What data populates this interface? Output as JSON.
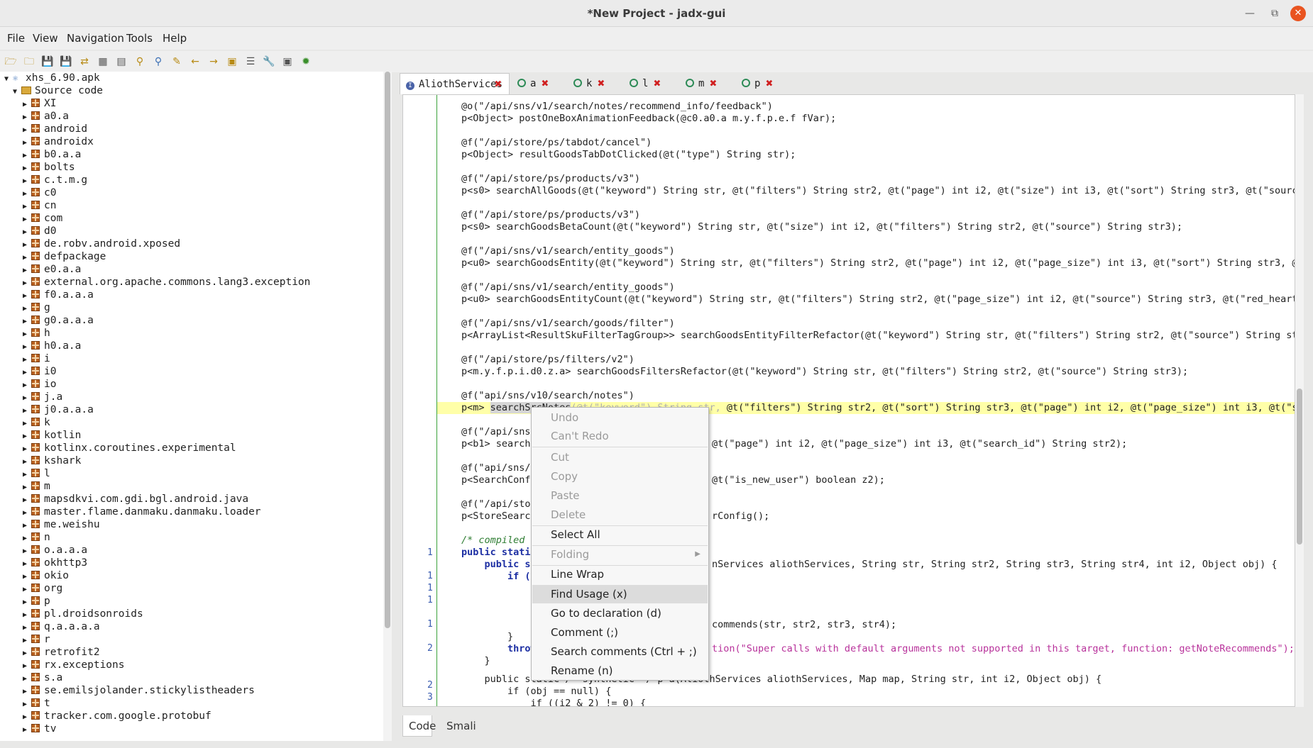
{
  "window": {
    "title": "*New Project - jadx-gui",
    "min_icon": "minimize-icon",
    "max_icon": "maximize-icon",
    "close_icon": "close-icon"
  },
  "menubar": [
    "File",
    "View",
    "Navigation",
    "Tools",
    "Help"
  ],
  "toolbar_icons": [
    "open-folder-icon",
    "add-files-icon",
    "save-icon",
    "save-all-icon",
    "export-icon",
    "sync-icon",
    "flatten-icon",
    "key-icon",
    "search-icon",
    "find-text-icon",
    "back-icon",
    "forward-icon",
    "quark-icon",
    "log-icon",
    "preferences-icon",
    "deobfuscation-icon",
    "debug-icon"
  ],
  "tree": {
    "root": "xhs_6.90.apk",
    "source": "Source code",
    "packages": [
      "XI",
      "a0.a",
      "android",
      "androidx",
      "b0.a.a",
      "bolts",
      "c.t.m.g",
      "c0",
      "cn",
      "com",
      "d0",
      "de.robv.android.xposed",
      "defpackage",
      "e0.a.a",
      "external.org.apache.commons.lang3.exception",
      "f0.a.a.a",
      "g",
      "g0.a.a.a",
      "h",
      "h0.a.a",
      "i",
      "i0",
      "io",
      "j.a",
      "j0.a.a.a",
      "k",
      "kotlin",
      "kotlinx.coroutines.experimental",
      "kshark",
      "l",
      "m",
      "mapsdkvi.com.gdi.bgl.android.java",
      "master.flame.danmaku.danmaku.loader",
      "me.weishu",
      "n",
      "o.a.a.a",
      "okhttp3",
      "okio",
      "org",
      "p",
      "pl.droidsonroids",
      "q.a.a.a.a",
      "r",
      "retrofit2",
      "rx.exceptions",
      "s.a",
      "se.emilsjolander.stickylistheaders",
      "t",
      "tracker.com.google.protobuf",
      "tv"
    ]
  },
  "tabs": [
    {
      "label": "AliothServices",
      "active": true
    },
    {
      "label": "a"
    },
    {
      "label": "k"
    },
    {
      "label": "l"
    },
    {
      "label": "m"
    },
    {
      "label": "p"
    }
  ],
  "gutter": [
    "1",
    "1",
    "1",
    "1",
    "1",
    "2",
    "2",
    "3"
  ],
  "code": {
    "l1a": "@o(\"/api/sns/v1/search/notes/recommend_info/feedback\")",
    "l2a": "p<Object> postOneBoxAnimationFeedback(@c0.a0.a m.y.f.p.e.f fVar);",
    "l3a": "@f(\"/api/store/ps/tabdot/cancel\")",
    "l4a": "p<Object> resultGoodsTabDotClicked(@t(\"type\") String str);",
    "l5a": "@f(\"/api/store/ps/products/v3\")",
    "l6a": "p<s0> searchAllGoods(@t(\"keyword\") String str, @t(\"filters\") String str2, @t(\"page\") int i2, @t(\"size\") int i3, @t(\"sort\") String str3, @t(\"source\"",
    "l7a": "@f(\"/api/store/ps/products/v3\")",
    "l8a": "p<s0> searchGoodsBetaCount(@t(\"keyword\") String str, @t(\"size\") int i2, @t(\"filters\") String str2, @t(\"source\") String str3);",
    "l9a": "@f(\"/api/sns/v1/search/entity_goods\")",
    "l10a": "p<u0> searchGoodsEntity(@t(\"keyword\") String str, @t(\"filters\") String str2, @t(\"page\") int i2, @t(\"page_size\") int i3, @t(\"sort\") String str3, @t(",
    "l11a": "@f(\"/api/sns/v1/search/entity_goods\")",
    "l12a": "p<u0> searchGoodsEntityCount(@t(\"keyword\") String str, @t(\"filters\") String str2, @t(\"page_size\") int i2, @t(\"source\") String str3, @t(\"red_heart\")",
    "l13a": "@f(\"/api/sns/v1/search/goods/filter\")",
    "l14a": "p<ArrayList<ResultSkuFilterTagGroup>> searchGoodsEntityFilterRefactor(@t(\"keyword\") String str, @t(\"filters\") String str2, @t(\"source\") String str3",
    "l15a": "@f(\"/api/store/ps/filters/v2\")",
    "l16a": "p<m.y.f.p.i.d0.z.a> searchGoodsFiltersRefactor(@t(\"keyword\") String str, @t(\"filters\") String str2, @t(\"source\") String str3);",
    "l17a": "@f(\"api/sns/v10/search/notes\")",
    "l18_pre": "p<m> ",
    "l18_sel": "searchSrcNotes",
    "l18_mid": "(@t(\"keyword\") String str,",
    "l18_post": " @t(\"filters\") String str2, @t(\"sort\") String str3, @t(\"page\") int i2, @t(\"page_size\") int i3, @t(\"sou",
    "l19a": "@f(\"/api/sns/",
    "l20a": "p<b1> search",
    "l20b": "@t(\"page\") int i2, @t(\"page_size\") int i3, @t(\"search_id\") String str2);",
    "l21a": "@f(\"api/sns/v",
    "l22a": "p<SearchConfi",
    "l22b": "@t(\"is_new_user\") boolean z2);",
    "l23a": "@f(\"/api/stor",
    "l24a": "p<StoreSearch",
    "l24b": "rConfig();",
    "l25a": "/* compiled",
    "l26a": "public static",
    "l27a": "    public st",
    "l27b": "nServices aliothServices, String str, String str2, String str3, String str4, int i2, Object obj) {",
    "l28a": "        if (",
    "l29a": "            ",
    "l31a": "            ",
    "l32b": "commends(str, str2, str3, str4);",
    "l33a": "        }",
    "l34a": "        throw",
    "l34b": "tion(\"Super calls with default arguments not supported in this target, function: getNoteRecommends\");",
    "l35a": "    }",
    "l36a": "    public static /* synthetic */ p a(AliothServices aliothServices, Map map, String str, int i2, Object obj) {",
    "l37a": "        if (obj == null) {",
    "l38a": "            if ((i2 & 2) != 0) {"
  },
  "bottom_tabs": [
    "Code",
    "Smali"
  ],
  "context_menu": {
    "undo": "Undo",
    "redo": "Can't Redo",
    "cut": "Cut",
    "copy": "Copy",
    "paste": "Paste",
    "delete": "Delete",
    "select_all": "Select All",
    "folding": "Folding",
    "line_wrap": "Line Wrap",
    "find_usage": "Find Usage (x)",
    "goto_decl": "Go to declaration (d)",
    "comment": "Comment (;)",
    "search_comments": "Search comments (Ctrl + ;)",
    "rename": "Rename (n)"
  }
}
